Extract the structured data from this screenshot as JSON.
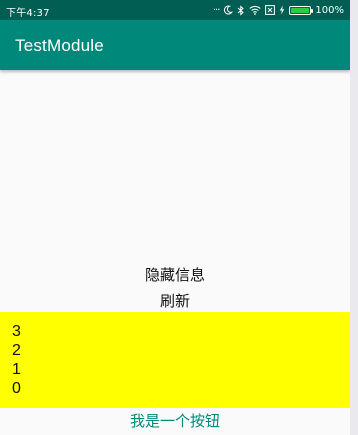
{
  "status_bar": {
    "time": "下午4:37",
    "icons": [
      "more-dots-icon",
      "moon-icon",
      "bluetooth-icon",
      "wifi-icon",
      "sim-x-icon",
      "charging-bolt-icon",
      "battery-icon"
    ],
    "more_dots": "...",
    "battery_percent": "100%",
    "battery_level": 1.0
  },
  "app_bar": {
    "title": "TestModule"
  },
  "main": {
    "hide_info_label": "隐藏信息",
    "refresh_label": "刷新",
    "yellow_list": [
      "3",
      "2",
      "1",
      "0"
    ],
    "bottom_button_label": "我是一个按钮"
  },
  "colors": {
    "status_bar": "#005f52",
    "app_bar": "#00897b",
    "accent": "#00897b",
    "highlight_box": "#ffff00",
    "battery_fill": "#2ecc40"
  }
}
